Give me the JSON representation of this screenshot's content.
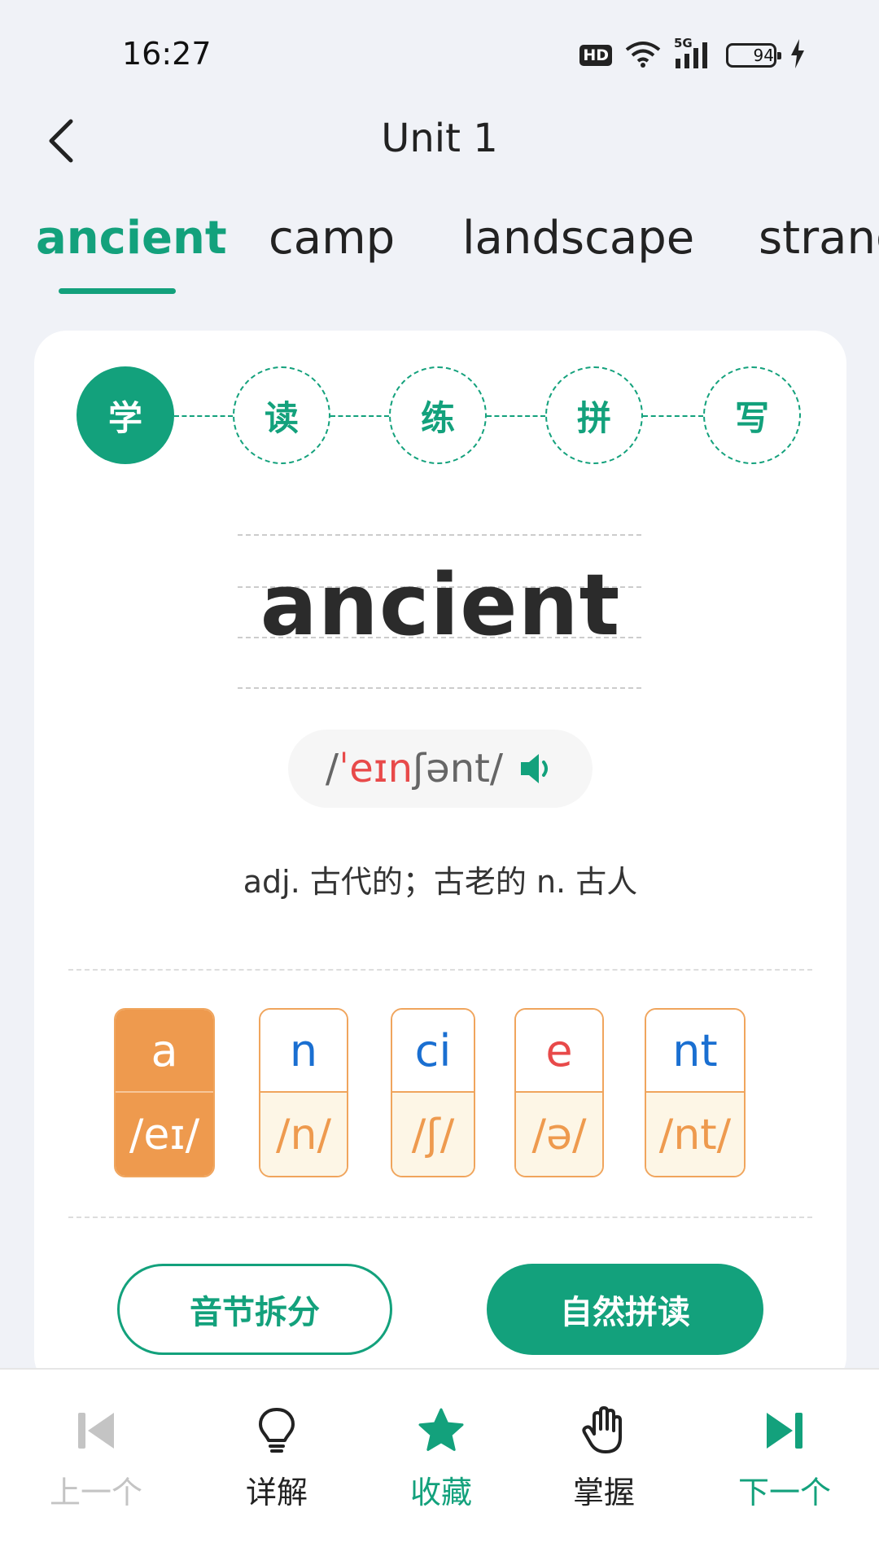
{
  "status_bar": {
    "time": "16:27",
    "hd": "HD",
    "network": "5G",
    "battery": "94"
  },
  "header": {
    "title": "Unit 1"
  },
  "word_tabs": [
    "ancient",
    "camp",
    "landscape",
    "strange"
  ],
  "steps": [
    "学",
    "读",
    "练",
    "拼",
    "写"
  ],
  "word": {
    "text": "ancient",
    "phonetic_open": "/",
    "phonetic_stress": "ˈeɪn",
    "phonetic_rest": "ʃənt/",
    "definition": "adj. 古代的；古老的 n. 古人"
  },
  "syllables": [
    {
      "letters": "a",
      "ipa": "/eɪ/",
      "letter_color": "#ffffff"
    },
    {
      "letters": "n",
      "ipa": "/n/",
      "letter_color": "#1a6fd1"
    },
    {
      "letters": "ci",
      "ipa": "/ʃ/",
      "letter_color": "#1a6fd1"
    },
    {
      "letters": "e",
      "ipa": "/ə/",
      "letter_color": "#e84a4a"
    },
    {
      "letters": "nt",
      "ipa": "/nt/",
      "letter_color": "#1a6fd1"
    }
  ],
  "buttons": {
    "syllable_split": "音节拆分",
    "natural_phonics": "自然拼读"
  },
  "bottom_nav": [
    {
      "label": "上一个",
      "icon": "skip-previous-icon",
      "color": "#c4c4c4"
    },
    {
      "label": "详解",
      "icon": "lightbulb-icon",
      "color": "#222222"
    },
    {
      "label": "收藏",
      "icon": "star-icon",
      "color": "#13a17c"
    },
    {
      "label": "掌握",
      "icon": "hand-icon",
      "color": "#222222"
    },
    {
      "label": "下一个",
      "icon": "skip-next-icon",
      "color": "#13a17c"
    }
  ],
  "colors": {
    "accent": "#13a17c",
    "syllable_orange": "#ee9a4e",
    "stress_red": "#e84a4a",
    "letter_blue": "#1a6fd1"
  }
}
